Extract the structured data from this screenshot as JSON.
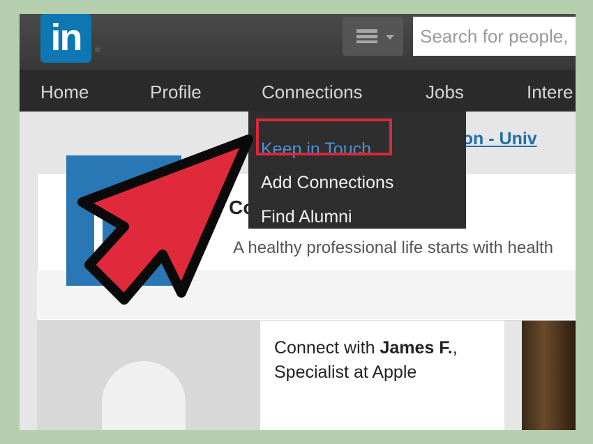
{
  "app": {
    "logo_text": "in",
    "logo_reg": "®"
  },
  "header": {
    "search_placeholder": "Search for people,"
  },
  "nav": {
    "items": [
      {
        "label": "Home"
      },
      {
        "label": "Profile"
      },
      {
        "label": "Connections"
      },
      {
        "label": "Jobs"
      },
      {
        "label": "Intere"
      }
    ]
  },
  "dropdown": {
    "items": [
      {
        "label": "Keep in Touch",
        "highlighted": true
      },
      {
        "label": "Add Connections"
      },
      {
        "label": "Find Alumni"
      }
    ]
  },
  "main": {
    "headline_link": "ssion - Univ",
    "card_title": "Co",
    "card_subtitle": "A healthy professional life starts with health",
    "connect_prefix": "Connect with ",
    "connect_name": "James F.",
    "connect_suffix": ", Specialist at Apple"
  },
  "colors": {
    "brand": "#0e76b3",
    "highlight": "#d8293a",
    "active_link": "#4a90d9"
  },
  "icons": [
    "menu-icon",
    "caret-down-icon",
    "pointer-arrow-icon"
  ]
}
